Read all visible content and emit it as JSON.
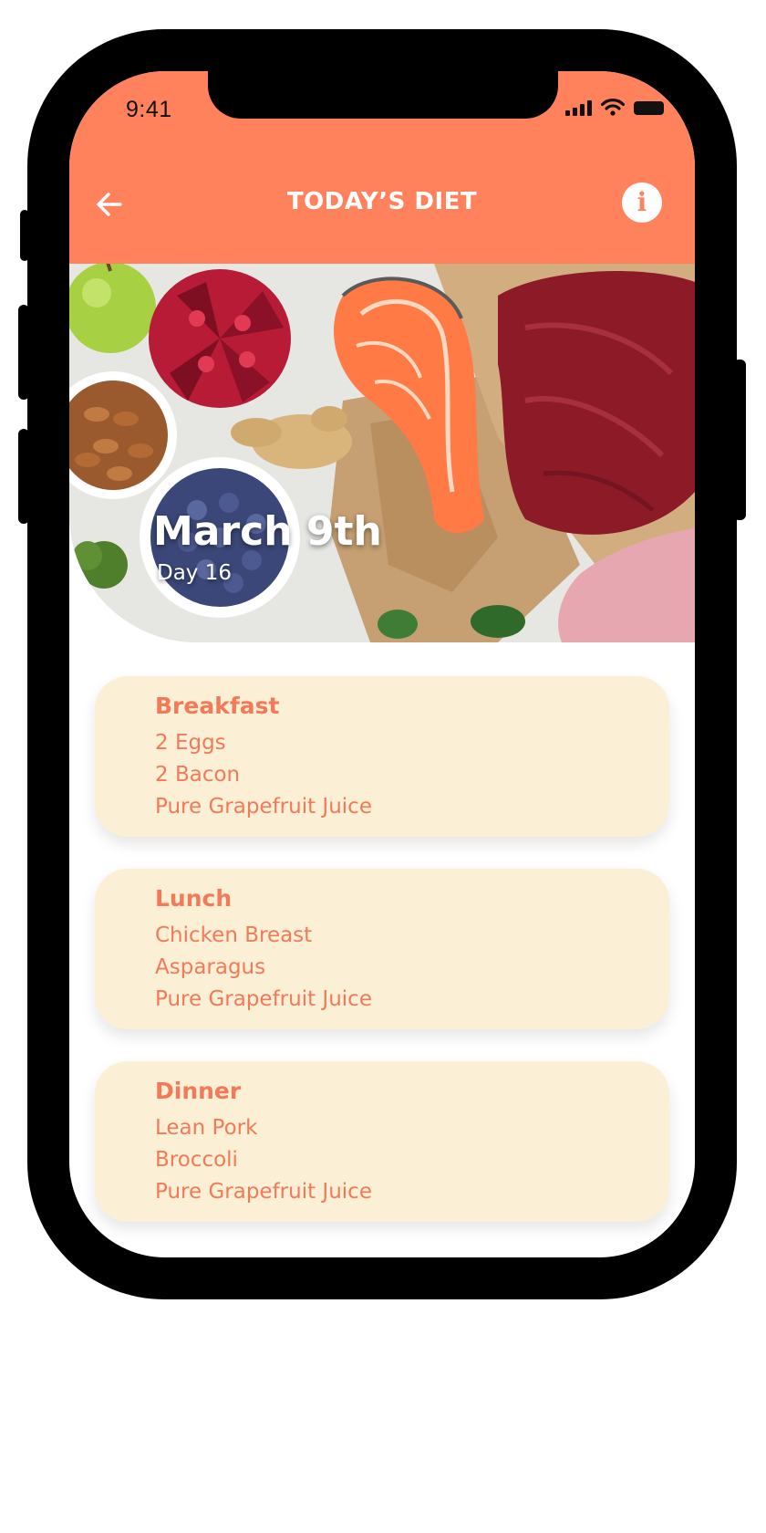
{
  "status_bar": {
    "time": "9:41"
  },
  "header": {
    "title": "TODAY’S DIET",
    "back_icon": "arrow-left-icon",
    "info_icon": "info-icon",
    "info_glyph": "i"
  },
  "hero": {
    "date": "March 9th",
    "day": "Day 16"
  },
  "meals": [
    {
      "title": "Breakfast",
      "items": [
        "2 Eggs",
        "2 Bacon",
        "Pure Grapefruit Juice"
      ]
    },
    {
      "title": "Lunch",
      "items": [
        "Chicken Breast",
        "Asparagus",
        "Pure Grapefruit Juice"
      ]
    },
    {
      "title": "Dinner",
      "items": [
        "Lean Pork",
        "Broccoli",
        "Pure Grapefruit Juice"
      ]
    }
  ],
  "colors": {
    "accent": "#ff825d",
    "card_background": "#fbf0d6",
    "card_text": "#f27a58"
  }
}
